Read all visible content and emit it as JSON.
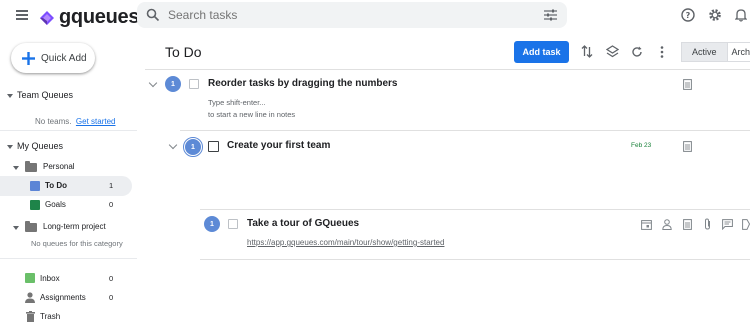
{
  "app": {
    "logo_text": "gqueues"
  },
  "search": {
    "placeholder": "Search tasks"
  },
  "sidebar": {
    "quick_add_label": "Quick Add",
    "team_queues": {
      "label": "Team Queues",
      "empty_text": "No teams.",
      "link": "Get started"
    },
    "my_queues": {
      "label": "My Queues"
    },
    "personal": {
      "label": "Personal"
    },
    "todo": {
      "label": "To Do",
      "count": "1",
      "color": "#5c85d6"
    },
    "goals": {
      "label": "Goals",
      "count": "0",
      "color": "#1e8449"
    },
    "long_term": {
      "label": "Long-term project",
      "empty_text": "No queues for this category"
    },
    "inbox": {
      "label": "Inbox",
      "count": "0",
      "color": "#6abf69"
    },
    "assignments": {
      "label": "Assignments",
      "count": "0"
    },
    "trash": {
      "label": "Trash"
    }
  },
  "header": {
    "title": "To Do",
    "add_task": "Add task",
    "tab_active": "Active",
    "tab_archive": "Arch"
  },
  "tasks": [
    {
      "number": "1",
      "title": "Reorder tasks by dragging the numbers",
      "note_line1": "Type shift-enter...",
      "note_line2": "to start a new line in notes"
    },
    {
      "number": "1",
      "title": "Create your first team",
      "date": "Feb 23"
    },
    {
      "number": "1",
      "title": "Take a tour of GQueues",
      "link": "https://app.gqueues.com/main/tour/show/getting-started"
    }
  ]
}
